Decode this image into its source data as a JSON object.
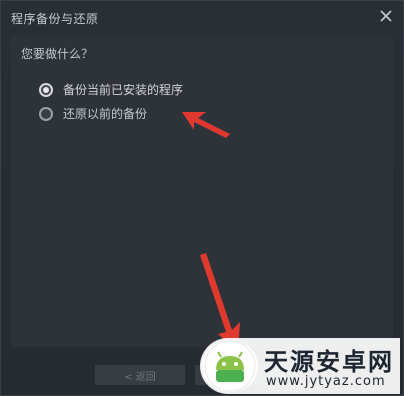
{
  "window": {
    "title": "程序备份与还原",
    "close_icon": "close-icon"
  },
  "main": {
    "question": "您要做什么？",
    "options": [
      {
        "label": "备份当前已安装的程序",
        "selected": true
      },
      {
        "label": "还原以前的备份",
        "selected": false
      }
    ]
  },
  "footer": {
    "back_label": "< 返回",
    "next_label": ""
  },
  "watermark": {
    "text_cn": "天源安卓网",
    "url": "www.jytyaz.com"
  },
  "colors": {
    "arrow": "#e03a2f",
    "background": "#2a2f36"
  }
}
